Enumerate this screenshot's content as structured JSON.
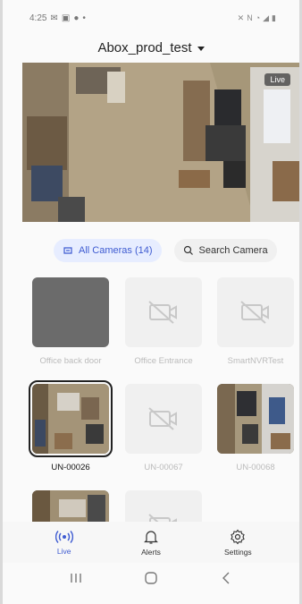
{
  "status_bar": {
    "time": "4:25",
    "left_icons": [
      "mail-icon",
      "image-icon",
      "notification-icon",
      "dot-icon"
    ],
    "right_icons": [
      "mute-icon",
      "nfc-icon",
      "wifi-icon",
      "signal-icon",
      "battery-icon"
    ]
  },
  "header": {
    "title": "Abox_prod_test"
  },
  "live_view": {
    "badge": "Live"
  },
  "filters": {
    "all_cameras_label": "All Cameras (14)",
    "search_label": "Search Camera"
  },
  "cameras": [
    {
      "name": "Office back door",
      "state": "gray"
    },
    {
      "name": "Office Entrance",
      "state": "offline"
    },
    {
      "name": "SmartNVRTest",
      "state": "offline"
    },
    {
      "name": "UN-00026",
      "state": "live",
      "selected": true
    },
    {
      "name": "UN-00067",
      "state": "offline"
    },
    {
      "name": "UN-00068",
      "state": "live"
    },
    {
      "name": "",
      "state": "live"
    },
    {
      "name": "",
      "state": "offline"
    }
  ],
  "bottom_nav": {
    "live_label": "Live",
    "alerts_label": "Alerts",
    "settings_label": "Settings"
  },
  "colors": {
    "accent": "#3e5bd1",
    "chip_active_bg": "#e7edff"
  }
}
